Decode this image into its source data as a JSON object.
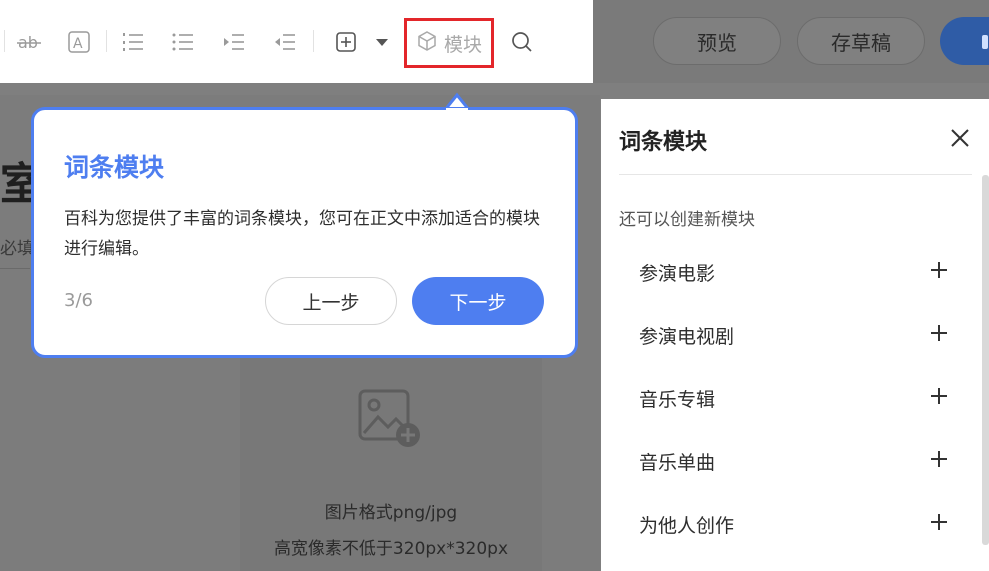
{
  "toolbar": {
    "items": [
      {
        "icon": "strikethrough-icon"
      },
      {
        "icon": "text-box-icon"
      },
      {
        "icon": "ordered-list-icon"
      },
      {
        "icon": "bullet-list-icon"
      },
      {
        "icon": "indent-icon"
      },
      {
        "icon": "outdent-icon"
      },
      {
        "icon": "insert-plus-icon"
      },
      {
        "icon": "dropdown-caret-icon"
      }
    ],
    "module_label": "模块",
    "search_icon": "search-icon"
  },
  "header_actions": {
    "preview_label": "预览",
    "draft_label": "存草稿"
  },
  "page": {
    "title_fragment": "室",
    "required_fragment": "必填",
    "upload_line1": "图片格式png/jpg",
    "upload_line2": "高宽像素不低于320px*320px"
  },
  "guide": {
    "title": "词条模块",
    "description": "百科为您提供了丰富的词条模块，您可在正文中添加适合的模块进行编辑。",
    "step": "3/6",
    "prev_label": "上一步",
    "next_label": "下一步"
  },
  "panel": {
    "title": "词条模块",
    "subtitle": "还可以创建新模块",
    "items": [
      {
        "label": "参演电影"
      },
      {
        "label": "参演电视剧"
      },
      {
        "label": "音乐专辑"
      },
      {
        "label": "音乐单曲"
      },
      {
        "label": "为他人创作"
      }
    ]
  },
  "colors": {
    "accent": "#4e7ef0",
    "highlight_border": "#e3262a",
    "overlay": "#7f7f7f"
  }
}
